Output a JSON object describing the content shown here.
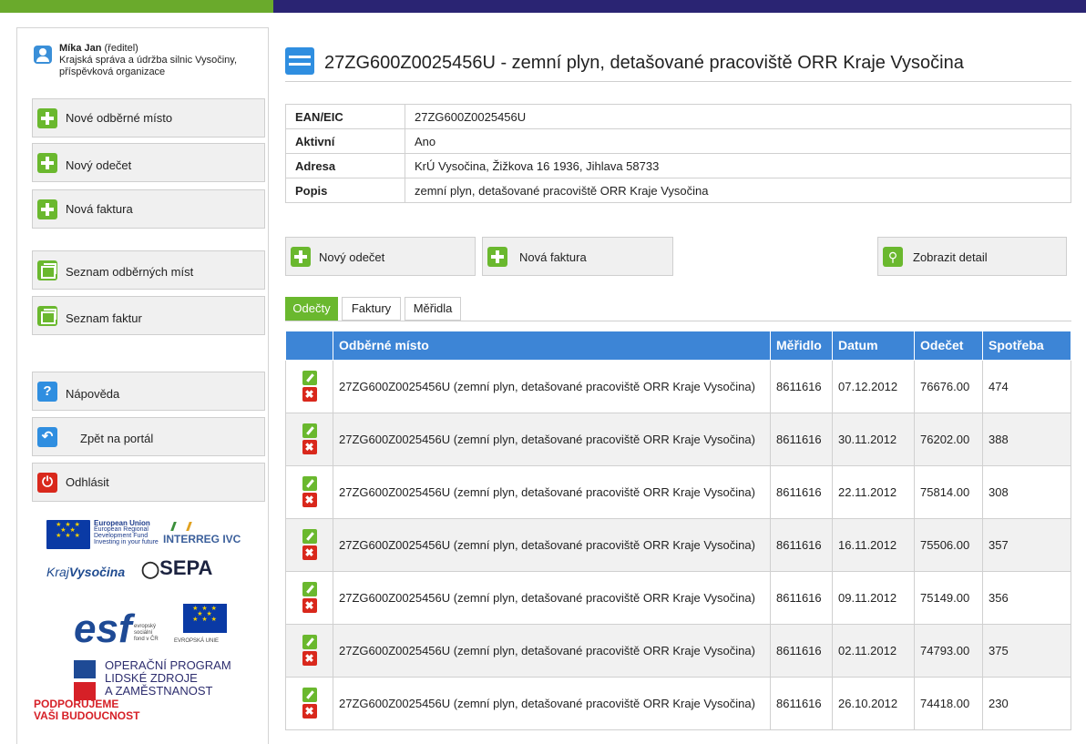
{
  "user": {
    "name": "Míka Jan",
    "role": "(ředitel)",
    "org": "Krajská správa a údržba silnic Vysočiny, příspěvková organizace"
  },
  "sidebar": {
    "new_point": "Nové odběrné místo",
    "new_reading": "Nový odečet",
    "new_invoice": "Nová faktura",
    "list_points": "Seznam odběrných míst",
    "list_invoices": "Seznam faktur",
    "help": "Nápověda",
    "back": "Zpět na portál",
    "logout": "Odhlásit"
  },
  "logos": {
    "eu_title": "European Union",
    "eu_sub1": "European Regional",
    "eu_sub2": "Development Fund",
    "eu_sub3": "Investing in your future",
    "interreg": "INTERREG IVC",
    "kraj1": "Kraj",
    "kraj2": "Vysočina",
    "sepa": "SEPA",
    "esf": "esf",
    "esf_small1": "evropský",
    "esf_small2": "sociální",
    "esf_small3": "fond v ČR",
    "esf_eu": "EVROPSKÁ UNIE",
    "opz1": "OPERAČNÍ PROGRAM",
    "opz2": "LIDSKÉ ZDROJE",
    "opz3": "A ZAMĚSTNANOST",
    "podp1": "PODPORUJEME",
    "podp2": "VAŠI BUDOUCNOST"
  },
  "page": {
    "title": "27ZG600Z0025456U - zemní plyn, detašované pracoviště ORR Kraje Vysočina"
  },
  "info": {
    "ean_label": "EAN/EIC",
    "ean_value": "27ZG600Z0025456U",
    "active_label": "Aktivní",
    "active_value": "Ano",
    "address_label": "Adresa",
    "address_value": "KrÚ Vysočina, Žižkova 16 1936, Jihlava 58733",
    "desc_label": "Popis",
    "desc_value": "zemní plyn, detašované pracoviště ORR Kraje Vysočina"
  },
  "actions": {
    "new_reading": "Nový odečet",
    "new_invoice": "Nová faktura",
    "show_detail": "Zobrazit detail"
  },
  "tabs": {
    "readings": "Odečty",
    "invoices": "Faktury",
    "meters": "Měřidla"
  },
  "grid": {
    "headers": {
      "place": "Odběrné místo",
      "meter": "Měřidlo",
      "date": "Datum",
      "reading": "Odečet",
      "consumption": "Spotřeba"
    },
    "rows": [
      {
        "place": "27ZG600Z0025456U (zemní plyn, detašované pracoviště ORR Kraje Vysočina)",
        "meter": "8611616",
        "date": "07.12.2012",
        "reading": "76676.00",
        "consumption": "474"
      },
      {
        "place": "27ZG600Z0025456U (zemní plyn, detašované pracoviště ORR Kraje Vysočina)",
        "meter": "8611616",
        "date": "30.11.2012",
        "reading": "76202.00",
        "consumption": "388"
      },
      {
        "place": "27ZG600Z0025456U (zemní plyn, detašované pracoviště ORR Kraje Vysočina)",
        "meter": "8611616",
        "date": "22.11.2012",
        "reading": "75814.00",
        "consumption": "308"
      },
      {
        "place": "27ZG600Z0025456U (zemní plyn, detašované pracoviště ORR Kraje Vysočina)",
        "meter": "8611616",
        "date": "16.11.2012",
        "reading": "75506.00",
        "consumption": "357"
      },
      {
        "place": "27ZG600Z0025456U (zemní plyn, detašované pracoviště ORR Kraje Vysočina)",
        "meter": "8611616",
        "date": "09.11.2012",
        "reading": "75149.00",
        "consumption": "356"
      },
      {
        "place": "27ZG600Z0025456U (zemní plyn, detašované pracoviště ORR Kraje Vysočina)",
        "meter": "8611616",
        "date": "02.11.2012",
        "reading": "74793.00",
        "consumption": "375"
      },
      {
        "place": "27ZG600Z0025456U (zemní plyn, detašované pracoviště ORR Kraje Vysočina)",
        "meter": "8611616",
        "date": "26.10.2012",
        "reading": "74418.00",
        "consumption": "230"
      }
    ]
  }
}
